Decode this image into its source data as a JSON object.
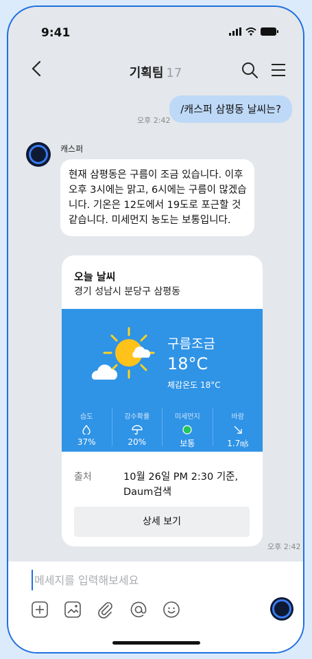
{
  "status_bar": {
    "time": "9:41"
  },
  "header": {
    "title": "기획팀",
    "member_count": "17"
  },
  "messages": {
    "user_text": "/캐스퍼 삼평동 날씨는?",
    "user_time": "오후 2:42",
    "bot_name": "캐스퍼",
    "bot_text": "현재 삼평동은 구름이 조금 있습니다. 이후 오후 3시에는 맑고, 6시에는 구름이 많겠습니다. 기온은 12도에서 19도로 포근할 것 같습니다. 미세먼지 농도는 보통입니다.",
    "bot_time": "오후 2:42"
  },
  "weather_card": {
    "title": "오늘 날씨",
    "location": "경기 성남시 분당구 삼평동",
    "condition": "구름조금",
    "temperature": "18°C",
    "feels_like": "체감온도 18°C",
    "stats": [
      {
        "label": "습도",
        "icon": "droplet-icon",
        "value": "37%"
      },
      {
        "label": "강수확률",
        "icon": "umbrella-icon",
        "value": "20%"
      },
      {
        "label": "미세먼지",
        "icon": "dust-status-dot-icon",
        "value": "보통"
      },
      {
        "label": "바람",
        "icon": "wind-arrow-icon",
        "value": "1.7㎧"
      }
    ],
    "source_label": "출처",
    "source_value": "10월 26일 PM 2:30 기준, Daum검색",
    "detail_button": "상세 보기"
  },
  "composer": {
    "placeholder": "메세지를 입력해보세요",
    "tools": [
      "plus-icon",
      "image-icon",
      "paperclip-icon",
      "at-icon",
      "emoji-icon"
    ]
  },
  "colors": {
    "accent": "#1e6fe0",
    "weather_bg": "#2f93e6",
    "user_bubble": "#bed9f7",
    "dust_good": "#22c55e"
  }
}
